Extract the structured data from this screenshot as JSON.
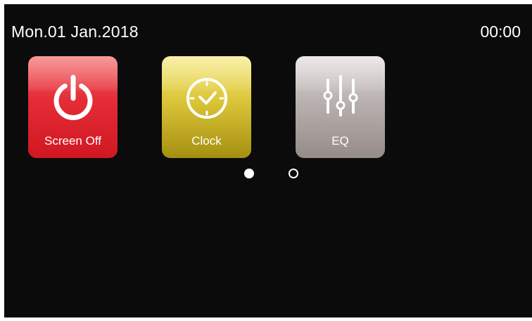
{
  "status_bar": {
    "date": "Mon.01 Jan.2018",
    "time": "00:00"
  },
  "apps": [
    {
      "label": "Screen Off",
      "icon": "power-icon",
      "color": "#e42d37"
    },
    {
      "label": "Clock",
      "icon": "clock-icon",
      "color": "#dcc73a"
    },
    {
      "label": "EQ",
      "icon": "equalizer-sliders-icon",
      "color": "#bbb3b1"
    }
  ],
  "pager": {
    "pages": 2,
    "current_page": 1
  }
}
